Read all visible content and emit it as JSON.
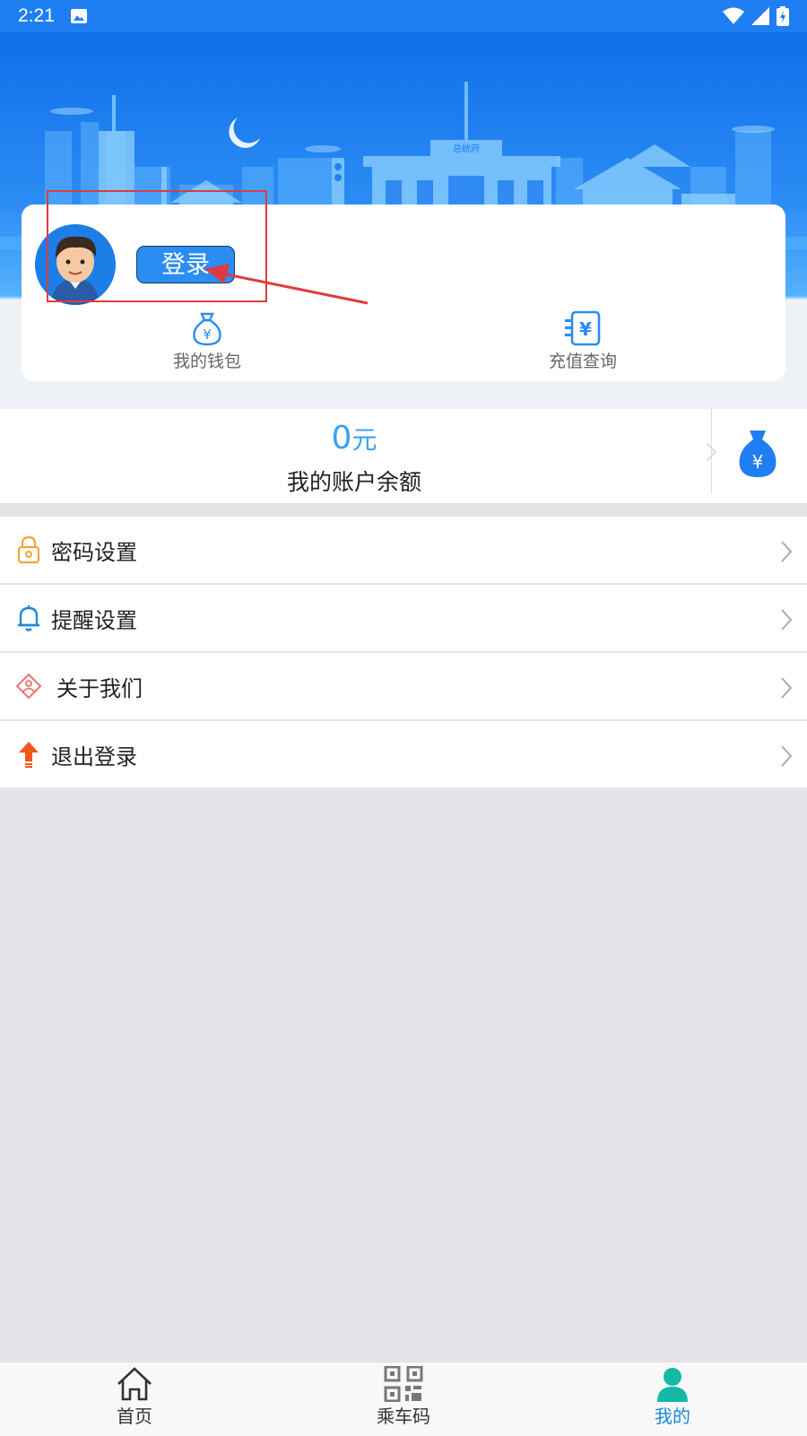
{
  "status_bar": {
    "time": "2:21",
    "icons": [
      "image-icon",
      "wifi-icon",
      "signal-icon",
      "battery-icon"
    ]
  },
  "profile": {
    "login_label": "登录",
    "actions": [
      {
        "label": "我的钱包",
        "icon": "money-bag-icon"
      },
      {
        "label": "充值查询",
        "icon": "recharge-list-icon"
      }
    ]
  },
  "balance": {
    "amount": "0",
    "unit": "元",
    "label": "我的账户余额"
  },
  "menu": [
    {
      "label": "密码设置",
      "icon": "lock-icon"
    },
    {
      "label": "提醒设置",
      "icon": "bell-icon"
    },
    {
      "label": "关于我们",
      "icon": "about-diamond-icon"
    },
    {
      "label": "退出登录",
      "icon": "logout-arrow-icon"
    }
  ],
  "bottom_nav": [
    {
      "label": "首页",
      "icon": "home-icon"
    },
    {
      "label": "乘车码",
      "icon": "qr-code-icon"
    },
    {
      "label": "我的",
      "icon": "person-icon",
      "active": true
    }
  ],
  "colors": {
    "primary": "#1f7ef2",
    "accent": "#3aa1f0",
    "active_nav": "#1b87e0",
    "annotation": "#e03a3f"
  },
  "skyline_sign": "总统府"
}
